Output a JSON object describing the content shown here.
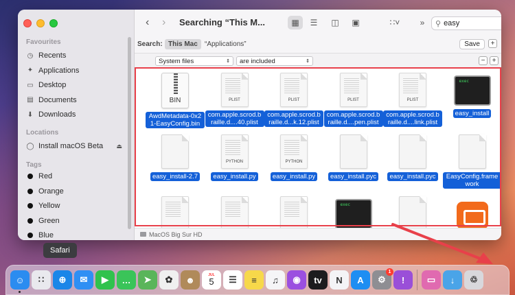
{
  "finder": {
    "title": "Searching “This M...",
    "search_value": "easy",
    "scope_label": "Search:",
    "scope_this_mac": "This Mac",
    "scope_applications": "“Applications”",
    "save_label": "Save",
    "filter_attribute": "System files",
    "filter_operator": "are included",
    "statusbar_path": "MacOS Big Sur HD",
    "plus": "+",
    "minus": "−"
  },
  "sidebar": {
    "favourites_header": "Favourites",
    "favourites": [
      {
        "label": "Recents",
        "icon": "clock-icon"
      },
      {
        "label": "Applications",
        "icon": "applications-icon"
      },
      {
        "label": "Desktop",
        "icon": "desktop-icon"
      },
      {
        "label": "Documents",
        "icon": "documents-icon"
      },
      {
        "label": "Downloads",
        "icon": "downloads-icon"
      }
    ],
    "locations_header": "Locations",
    "locations": [
      {
        "label": "Install macOS Beta",
        "icon": "disk-icon"
      }
    ],
    "tags_header": "Tags",
    "tags": [
      {
        "label": "Red",
        "color": "#111111"
      },
      {
        "label": "Orange",
        "color": "#111111"
      },
      {
        "label": "Yellow",
        "color": "#111111"
      },
      {
        "label": "Green",
        "color": "#111111"
      },
      {
        "label": "Blue",
        "color": "#111111"
      }
    ]
  },
  "files": [
    {
      "name": "AwdMetadata-0x21-EasyConfig.bin",
      "kind": "bin",
      "tag": "BIN"
    },
    {
      "name": "com.apple.scrod.braille.d....40.plist",
      "kind": "doc",
      "tag": "PLIST"
    },
    {
      "name": "com.apple.scrod.braille.d...k.12.plist",
      "kind": "doc",
      "tag": "PLIST"
    },
    {
      "name": "com.apple.scrod.braille.d....pen.plist",
      "kind": "doc",
      "tag": "PLIST"
    },
    {
      "name": "com.apple.scrod.braille.d....link.plist",
      "kind": "doc",
      "tag": "PLIST"
    },
    {
      "name": "easy_install",
      "kind": "term",
      "tag": "exec"
    },
    {
      "name": "easy_install-2.7",
      "kind": "blank",
      "tag": ""
    },
    {
      "name": "easy_install.py",
      "kind": "doc",
      "tag": "PYTHON"
    },
    {
      "name": "easy_install.py",
      "kind": "doc",
      "tag": "PYTHON"
    },
    {
      "name": "easy_install.pyc",
      "kind": "blank",
      "tag": ""
    },
    {
      "name": "easy_install.pyc",
      "kind": "blank",
      "tag": ""
    },
    {
      "name": "EasyConfig.framework",
      "kind": "blank",
      "tag": ""
    },
    {
      "name": "",
      "kind": "doc",
      "tag": ""
    },
    {
      "name": "",
      "kind": "doc",
      "tag": ""
    },
    {
      "name": "",
      "kind": "doc",
      "tag": ""
    },
    {
      "name": "",
      "kind": "term",
      "tag": "exec"
    },
    {
      "name": "",
      "kind": "blank",
      "tag": ""
    },
    {
      "name": "",
      "kind": "app",
      "tag": ""
    }
  ],
  "tooltip": "Safari",
  "dock": {
    "apps": [
      {
        "name": "finder",
        "icon": "finder-icon",
        "color": "#2b8cf0",
        "glyph": "☺"
      },
      {
        "name": "launchpad",
        "icon": "launchpad-icon",
        "color": "#e9e9ee",
        "glyph": "∷"
      },
      {
        "name": "safari",
        "icon": "safari-icon",
        "color": "#1b86e8",
        "glyph": "⊕"
      },
      {
        "name": "mail",
        "icon": "mail-icon",
        "color": "#2f8ff4",
        "glyph": "✉"
      },
      {
        "name": "facetime",
        "icon": "facetime-icon",
        "color": "#30c24d",
        "glyph": "▶"
      },
      {
        "name": "messages",
        "icon": "messages-icon",
        "color": "#3ac459",
        "glyph": "…"
      },
      {
        "name": "maps",
        "icon": "maps-icon",
        "color": "#5ab55a",
        "glyph": "➤"
      },
      {
        "name": "photos",
        "icon": "photos-icon",
        "color": "#f0f0f0",
        "glyph": "✿"
      },
      {
        "name": "contacts",
        "icon": "contacts-icon",
        "color": "#b08a5a",
        "glyph": "☻"
      },
      {
        "name": "calendar",
        "icon": "calendar-icon",
        "color": "#ffffff",
        "glyph": "5"
      },
      {
        "name": "reminders",
        "icon": "reminders-icon",
        "color": "#ffffff",
        "glyph": "☰"
      },
      {
        "name": "notes",
        "icon": "notes-icon",
        "color": "#f7d84a",
        "glyph": "≡"
      },
      {
        "name": "music",
        "icon": "music-icon",
        "color": "#f5f5f7",
        "glyph": "♫"
      },
      {
        "name": "podcasts",
        "icon": "podcasts-icon",
        "color": "#9b4fe0",
        "glyph": "◉"
      },
      {
        "name": "tv",
        "icon": "tv-icon",
        "color": "#1c1c1e",
        "glyph": "tv"
      },
      {
        "name": "news",
        "icon": "news-icon",
        "color": "#f4f4f6",
        "glyph": "N"
      },
      {
        "name": "app-store",
        "icon": "app-store-icon",
        "color": "#1e8ef2",
        "glyph": "A"
      },
      {
        "name": "system-preferences",
        "icon": "gear-icon",
        "color": "#8e8e93",
        "glyph": "⚙",
        "badge": "1"
      },
      {
        "name": "feedback",
        "icon": "feedback-icon",
        "color": "#9a4fd8",
        "glyph": "!"
      }
    ],
    "right": [
      {
        "name": "screen",
        "icon": "screen-icon",
        "color": "#e06ab0",
        "glyph": "▭"
      },
      {
        "name": "downloads-stack",
        "icon": "downloads-folder-icon",
        "color": "#4aa4e8",
        "glyph": "↓"
      },
      {
        "name": "trash",
        "icon": "trash-icon",
        "color": "#d8d8dc",
        "glyph": "♲"
      }
    ],
    "calendar_month": "JUL",
    "tv_label": "tv"
  }
}
